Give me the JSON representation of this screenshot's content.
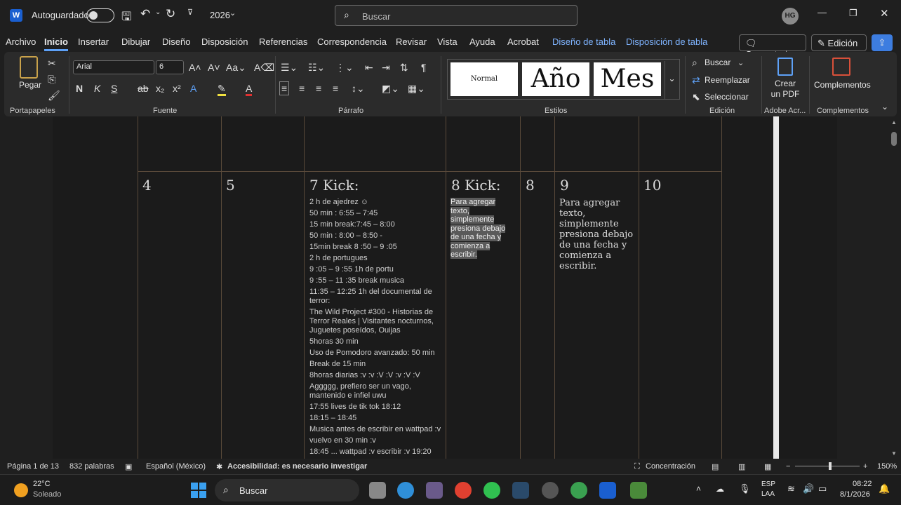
{
  "titlebar": {
    "autosave_label": "Autoguardado",
    "doc_name": "2026",
    "search_placeholder": "Buscar",
    "user_initials": "HG"
  },
  "menu": {
    "items": [
      "Archivo",
      "Inicio",
      "Insertar",
      "Dibujar",
      "Diseño",
      "Disposición",
      "Referencias",
      "Correspondencia",
      "Revisar",
      "Vista",
      "Ayuda",
      "Acrobat",
      "Diseño de tabla",
      "Disposición de tabla"
    ],
    "active": "Inicio",
    "comments_label": "Comentarios",
    "edit_mode_label": "Edición"
  },
  "ribbon": {
    "paste_label": "Pegar",
    "font_name": "Arial",
    "font_size": "6",
    "styles": [
      "Normal",
      "Año",
      "Mes"
    ],
    "find_label": "Buscar",
    "replace_label": "Reemplazar",
    "select_label": "Seleccionar",
    "pdf_label": "Crear un PDF",
    "addins_label": "Complementos",
    "groups": {
      "clipboard": "Portapapeles",
      "font": "Fuente",
      "paragraph": "Párrafo",
      "styles": "Estilos",
      "editing": "Edición",
      "adobe": "Adobe Acr...",
      "addins": "Complementos"
    }
  },
  "document": {
    "day_numbers": [
      "4",
      "5",
      "7 Kick:",
      "8 Kick:",
      "8",
      "9",
      "10"
    ],
    "entries_day7": [
      "2 h de ajedrez ☺",
      "50 min : 6:55 – 7:45",
      "15 min break:7:45 – 8:00",
      "50 min : 8:00 – 8:50 -",
      "15min break 8 :50 – 9 :05",
      "2 h de portugues",
      "9 :05 – 9 :55 1h de portu",
      "9 :55 – 11 :35 break musica",
      "11:35 – 12:25 1h del documental de terror:",
      "The Wild Project #300 - Historias de Terror Reales | Visitantes nocturnos, Juguetes poseídos, Ouijas",
      "5horas 30 min",
      "Uso de Pomodoro avanzado: 50 min",
      "Break de 15 min",
      "8horas diarias :v :v :V :V :v :V :V",
      "Aggggg, prefiero ser un vago, mantenido e infiel uwu",
      "17:55 lives de tik tok 18:12",
      "18:15 – 18:45",
      "Musica antes de escribir en wattpad :v",
      "vuelvo en 30 min :v",
      "18:45 ... wattpad :v escribir :v 19:20"
    ],
    "placeholder_day8": "Para agregar texto, simplemente presiona debajo de una fecha y comienza a escribir.",
    "placeholder_day9": "Para agregar texto, simplemente presiona debajo de una fecha y comienza a escribir."
  },
  "status": {
    "page": "Página 1 de 13",
    "words": "832 palabras",
    "language": "Español (México)",
    "accessibility": "Accesibilidad: es necesario investigar",
    "focus": "Concentración",
    "zoom": "150%"
  },
  "taskbar": {
    "weather_temp": "22°C",
    "weather_desc": "Soleado",
    "search_label": "Buscar",
    "lang_top": "ESP",
    "lang_bottom": "LAA",
    "time": "08:22",
    "date": "8/1/2026"
  }
}
